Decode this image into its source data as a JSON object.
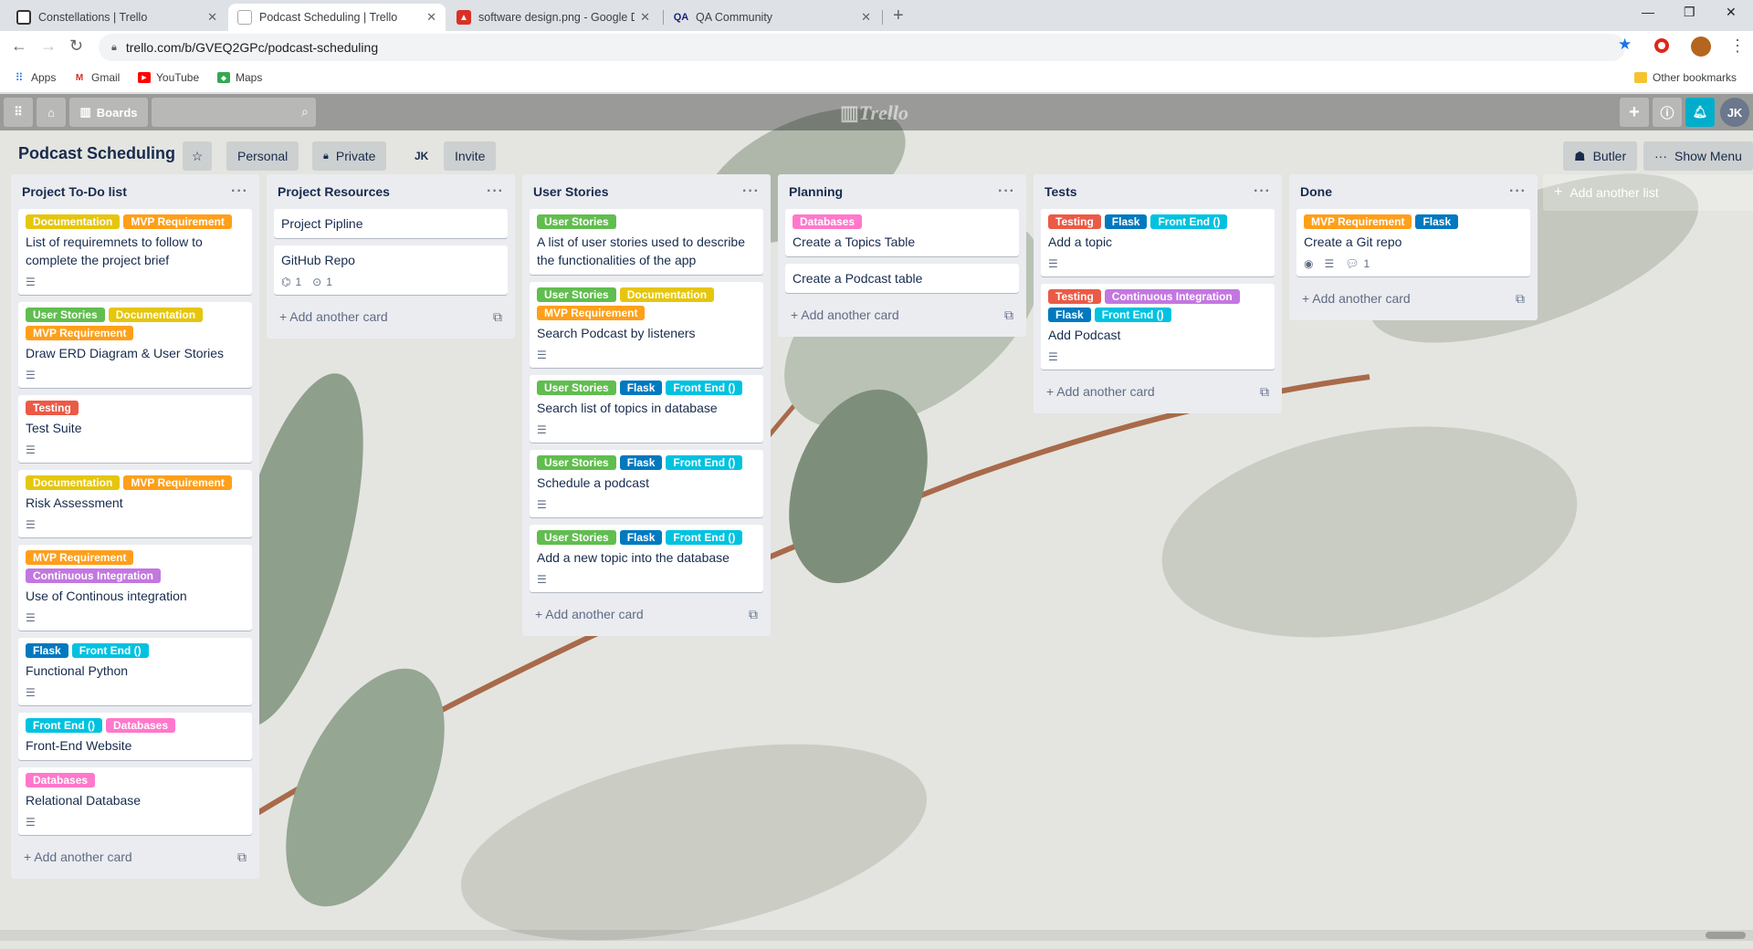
{
  "browser": {
    "tabs": [
      {
        "title": "Constellations | Trello",
        "icon": "trello-icon",
        "active": false
      },
      {
        "title": "Podcast Scheduling | Trello",
        "icon": "trello-icon",
        "active": true
      },
      {
        "title": "software design.png - Google Dr",
        "icon": "google-drive-image-icon",
        "active": false
      },
      {
        "title": "QA Community",
        "icon": "qa-icon",
        "active": false
      }
    ],
    "new_tab": "+",
    "url": "trello.com/b/GVEQ2GPc/podcast-scheduling",
    "bookmarks": [
      {
        "label": "Apps",
        "icon": "apps-grid-icon"
      },
      {
        "label": "Gmail",
        "icon": "gmail-icon"
      },
      {
        "label": "YouTube",
        "icon": "youtube-icon"
      },
      {
        "label": "Maps",
        "icon": "maps-icon"
      }
    ],
    "other_bookmarks": "Other bookmarks"
  },
  "header": {
    "boards_label": "Boards",
    "logo": "Trello",
    "avatar": "JK"
  },
  "board": {
    "title": "Podcast Scheduling",
    "team_label": "Personal",
    "visibility_label": "Private",
    "member_initials": "JK",
    "invite_label": "Invite",
    "butler_label": "Butler",
    "menu_label": "Show Menu",
    "add_list_label": "Add another list",
    "add_card_label": "Add another card"
  },
  "label_colors": {
    "Documentation": "#e6c60d",
    "MVP Requirement": "#ff9f1a",
    "User Stories": "#61bd4f",
    "Testing": "#eb5a46",
    "Continuous Integration": "#c377e0",
    "Flask": "#0079bf",
    "Front End ()": "#00c2e0",
    "Databases": "#ff78cb"
  },
  "lists": [
    {
      "title": "Project To-Do list",
      "cards": [
        {
          "labels": [
            "Documentation",
            "MVP Requirement"
          ],
          "title": "List of requiremnets to follow to complete the project brief",
          "description": true
        },
        {
          "labels": [
            "User Stories",
            "Documentation",
            "MVP Requirement"
          ],
          "title": "Draw ERD Diagram & User Stories",
          "description": true
        },
        {
          "labels": [
            "Testing"
          ],
          "title": "Test Suite",
          "description": true
        },
        {
          "labels": [
            "Documentation",
            "MVP Requirement"
          ],
          "title": "Risk Assessment",
          "description": true
        },
        {
          "labels": [
            "MVP Requirement",
            "Continuous Integration"
          ],
          "title": "Use of Continous integration",
          "description": true
        },
        {
          "labels": [
            "Flask",
            "Front End ()"
          ],
          "title": "Functional Python",
          "description": true
        },
        {
          "labels": [
            "Front End ()",
            "Databases"
          ],
          "title": "Front-End Website",
          "description": false
        },
        {
          "labels": [
            "Databases"
          ],
          "title": "Relational Database",
          "description": true
        }
      ]
    },
    {
      "title": "Project Resources",
      "cards": [
        {
          "labels": [],
          "title": "Project Pipline",
          "description": false
        },
        {
          "labels": [],
          "title": "GitHub Repo",
          "description": false,
          "attachments": "1",
          "github": "1"
        }
      ]
    },
    {
      "title": "User Stories",
      "cards": [
        {
          "labels": [
            "User Stories"
          ],
          "title": "A list of user stories used to describe the functionalities of the app",
          "description": false
        },
        {
          "labels": [
            "User Stories",
            "Documentation",
            "MVP Requirement"
          ],
          "title": "Search Podcast by listeners",
          "description": true
        },
        {
          "labels": [
            "User Stories",
            "Flask",
            "Front End ()"
          ],
          "title": "Search list of topics in database",
          "description": true
        },
        {
          "labels": [
            "User Stories",
            "Flask",
            "Front End ()"
          ],
          "title": "Schedule a podcast",
          "description": true
        },
        {
          "labels": [
            "User Stories",
            "Flask",
            "Front End ()"
          ],
          "title": "Add a new topic into the database",
          "description": true
        }
      ]
    },
    {
      "title": "Planning",
      "cards": [
        {
          "labels": [
            "Databases"
          ],
          "title": "Create a Topics Table",
          "description": false
        },
        {
          "labels": [],
          "title": "Create a Podcast table",
          "description": false
        }
      ]
    },
    {
      "title": "Tests",
      "cards": [
        {
          "labels": [
            "Testing",
            "Flask",
            "Front End ()"
          ],
          "title": "Add a topic",
          "description": true
        },
        {
          "labels": [
            "Testing",
            "Continuous Integration",
            "Flask",
            "Front End ()"
          ],
          "title": "Add Podcast",
          "description": true
        }
      ]
    },
    {
      "title": "Done",
      "cards": [
        {
          "labels": [
            "MVP Requirement",
            "Flask"
          ],
          "title": "Create a Git repo",
          "description": true,
          "watching": true,
          "comments": "1"
        }
      ]
    }
  ]
}
